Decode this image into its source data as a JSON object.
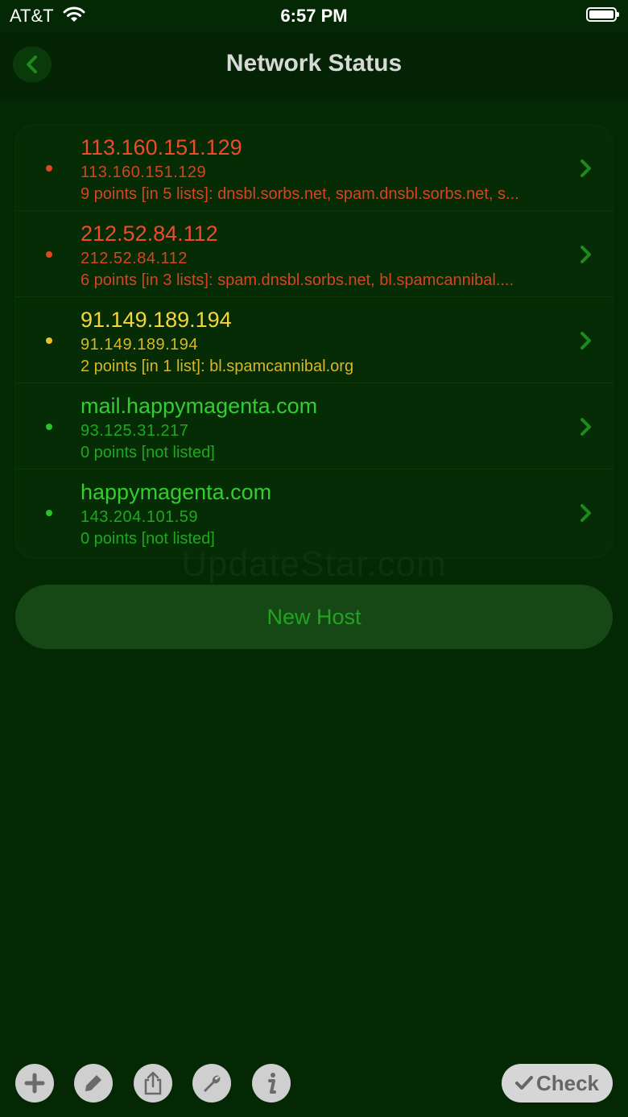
{
  "status_bar": {
    "carrier": "AT&T",
    "time": "6:57 PM"
  },
  "nav": {
    "title": "Network Status",
    "back_icon": "chevron-left-icon"
  },
  "hosts": [
    {
      "name": "113.160.151.129",
      "ip": "113.160.151.129",
      "detail": "9 points [in 5 lists]: dnsbl.sorbs.net, spam.dnsbl.sorbs.net, s...",
      "status": "red"
    },
    {
      "name": "212.52.84.112",
      "ip": "212.52.84.112",
      "detail": "6 points [in 3 lists]: spam.dnsbl.sorbs.net, bl.spamcannibal....",
      "status": "red"
    },
    {
      "name": "91.149.189.194",
      "ip": "91.149.189.194",
      "detail": "2 points [in 1 list]: bl.spamcannibal.org",
      "status": "yellow"
    },
    {
      "name": "mail.happymagenta.com",
      "ip": "93.125.31.217",
      "detail": "0 points [not listed]",
      "status": "green"
    },
    {
      "name": "happymagenta.com",
      "ip": "143.204.101.59",
      "detail": "0 points [not listed]",
      "status": "green"
    }
  ],
  "watermark": "UpdateStar.com",
  "new_host_label": "New Host",
  "toolbar": {
    "icons": [
      "plus-icon",
      "pencil-icon",
      "share-icon",
      "wrench-icon",
      "info-icon"
    ],
    "check_label": "Check"
  },
  "colors": {
    "background": "#032803",
    "red": "#f04a2c",
    "yellow": "#f5d53a",
    "green": "#33cc33"
  }
}
